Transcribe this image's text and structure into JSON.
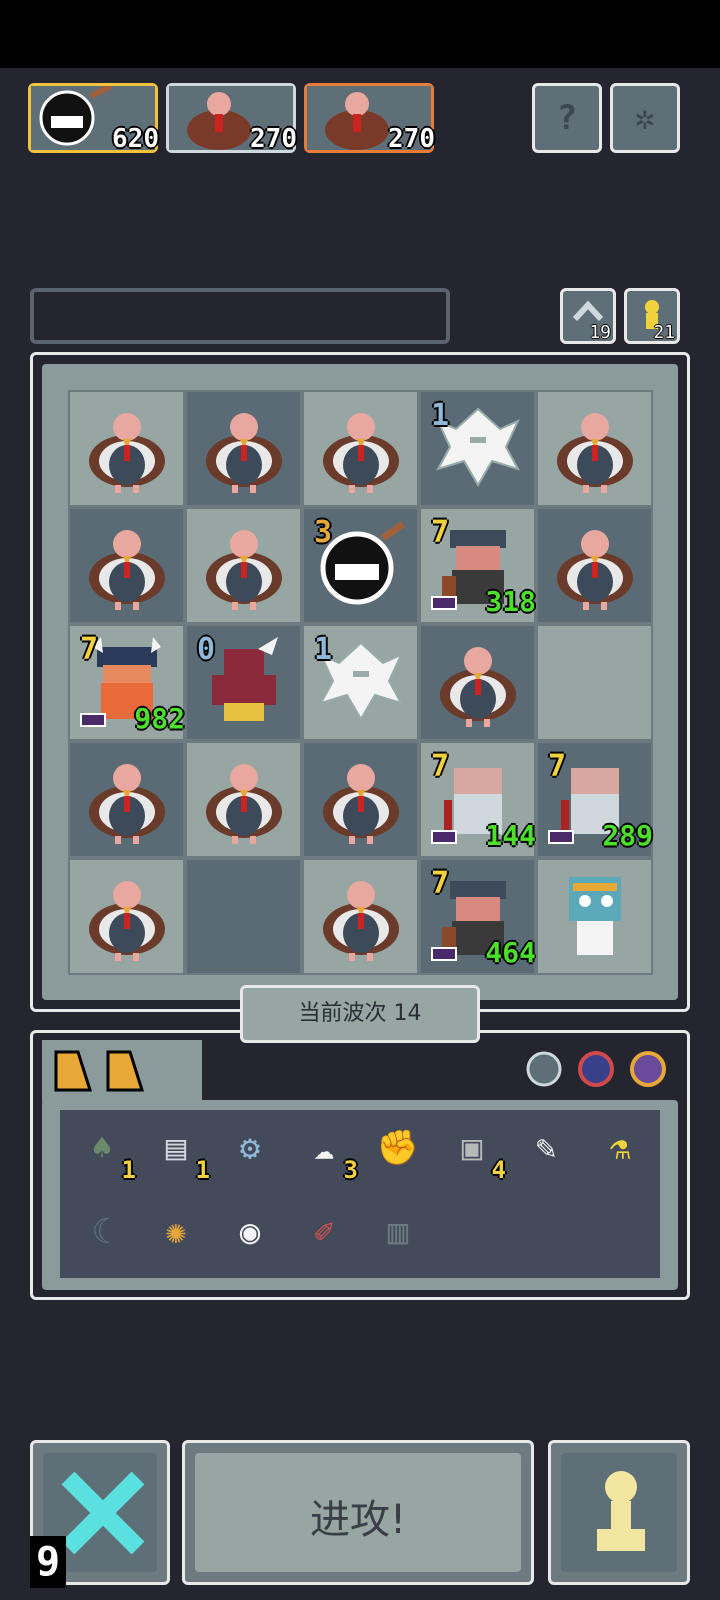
{
  "party": [
    {
      "name": "chomper",
      "value": "620"
    },
    {
      "name": "turkey",
      "value": "270"
    },
    {
      "name": "turkey",
      "value": "270"
    }
  ],
  "top_buttons": {
    "help_label": "?",
    "settings_label": "✲"
  },
  "counters": {
    "undo": "19",
    "reserve": "21"
  },
  "board": {
    "rows": [
      [
        {
          "t": "turkey"
        },
        {
          "t": "turkey"
        },
        {
          "t": "turkey"
        },
        {
          "t": "ghost",
          "lvl": "1"
        },
        {
          "t": "turkey"
        }
      ],
      [
        {
          "t": "turkey"
        },
        {
          "t": "turkey"
        },
        {
          "t": "chomper",
          "lvl": "3"
        },
        {
          "t": "dwarf",
          "lvl": "7",
          "hp": "318"
        },
        {
          "t": "turkey"
        }
      ],
      [
        {
          "t": "viking",
          "lvl": "7",
          "hp": "982"
        },
        {
          "t": "demon",
          "lvl": "0"
        },
        {
          "t": "ghost",
          "lvl": "1"
        },
        {
          "t": "turkey"
        },
        {
          "t": "empty"
        }
      ],
      [
        {
          "t": "turkey"
        },
        {
          "t": "turkey"
        },
        {
          "t": "turkey"
        },
        {
          "t": "elder",
          "lvl": "7",
          "hp": "144"
        },
        {
          "t": "elder",
          "lvl": "7",
          "hp": "289"
        }
      ],
      [
        {
          "t": "turkey"
        },
        {
          "t": "empty"
        },
        {
          "t": "turkey"
        },
        {
          "t": "dwarf",
          "lvl": "7",
          "hp": "464"
        },
        {
          "t": "zombie"
        }
      ]
    ]
  },
  "wave_label": "当前波次 14",
  "inventory": {
    "items": [
      {
        "name": "hood-icon",
        "glyph": "♠",
        "count": "1"
      },
      {
        "name": "scroll-icon",
        "glyph": "▤",
        "count": "1"
      },
      {
        "name": "network-icon",
        "glyph": "⚙",
        "count": ""
      },
      {
        "name": "cloud-icon",
        "glyph": "☁",
        "count": "3"
      },
      {
        "name": "gauntlet-icon",
        "glyph": "✊",
        "count": ""
      },
      {
        "name": "machine-icon",
        "glyph": "▣",
        "count": "4"
      },
      {
        "name": "feather-icon",
        "glyph": "✎",
        "count": ""
      },
      {
        "name": "potion-icon",
        "glyph": "⚗",
        "count": ""
      },
      {
        "name": "crescent-icon",
        "glyph": "☾",
        "count": ""
      },
      {
        "name": "flame-icon",
        "glyph": "✺",
        "count": ""
      },
      {
        "name": "eye-icon",
        "glyph": "◉",
        "count": ""
      },
      {
        "name": "syringe-icon",
        "glyph": "✐",
        "count": ""
      },
      {
        "name": "radio-icon",
        "glyph": "▥",
        "count": ""
      }
    ]
  },
  "attack_label": "进攻!",
  "remaining_moves": "9",
  "colors": {
    "accent_yellow": "#f2d23c",
    "hp_green": "#4de02a",
    "x_cyan": "#5be0e0"
  }
}
